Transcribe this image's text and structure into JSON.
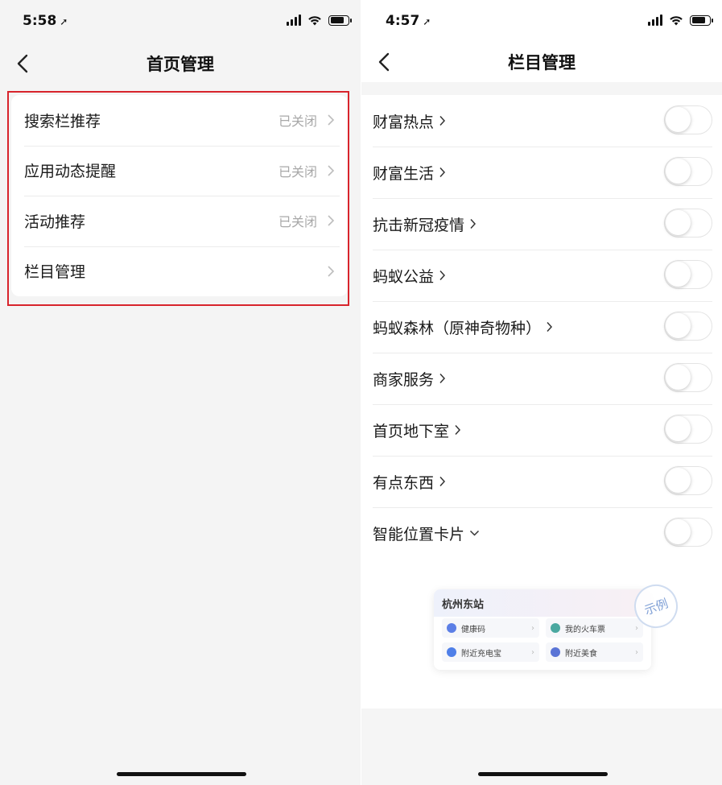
{
  "left": {
    "status": {
      "time": "5:58",
      "loc_icon": "location-arrow-icon"
    },
    "nav": {
      "title": "首页管理",
      "back_icon": "chevron-left-icon"
    },
    "items": [
      {
        "label": "搜索栏推荐",
        "status": "已关闭"
      },
      {
        "label": "应用动态提醒",
        "status": "已关闭"
      },
      {
        "label": "活动推荐",
        "status": "已关闭"
      },
      {
        "label": "栏目管理",
        "status": ""
      }
    ],
    "highlight_color": "#d8242c"
  },
  "right": {
    "status": {
      "time": "4:57",
      "loc_icon": "location-arrow-icon"
    },
    "nav": {
      "title": "栏目管理",
      "back_icon": "chevron-left-icon"
    },
    "columns": [
      {
        "label": "财富热点",
        "chevron": "right",
        "enabled": false
      },
      {
        "label": "财富生活",
        "chevron": "right",
        "enabled": false
      },
      {
        "label": "抗击新冠疫情",
        "chevron": "right",
        "enabled": false
      },
      {
        "label": "蚂蚁公益",
        "chevron": "right",
        "enabled": false
      },
      {
        "label": "蚂蚁森林（原神奇物种）",
        "chevron": "right",
        "enabled": false
      },
      {
        "label": "商家服务",
        "chevron": "right",
        "enabled": false
      },
      {
        "label": "首页地下室",
        "chevron": "right",
        "enabled": false
      },
      {
        "label": "有点东西",
        "chevron": "right",
        "enabled": false
      },
      {
        "label": "智能位置卡片",
        "chevron": "down",
        "enabled": false
      }
    ],
    "example_card": {
      "title": "杭州东站",
      "stamp": "示例",
      "items": [
        "健康码",
        "我的火车票",
        "附近充电宝",
        "附近美食"
      ]
    }
  }
}
